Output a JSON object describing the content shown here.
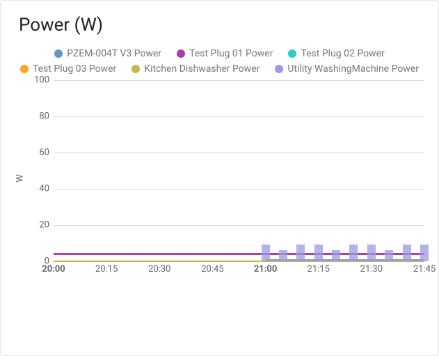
{
  "chart_data": {
    "type": "line",
    "title": "Power (W)",
    "ylabel": "W",
    "xlabel": "",
    "ylim": [
      0,
      100
    ],
    "y_ticks": [
      0,
      20,
      40,
      60,
      80,
      100
    ],
    "x_ticks": [
      "20:00",
      "20:15",
      "20:30",
      "20:45",
      "21:00",
      "21:15",
      "21:30",
      "21:45"
    ],
    "x_bold_ticks": [
      "20:00",
      "21:00"
    ],
    "categories": [
      "20:00",
      "20:05",
      "20:10",
      "20:15",
      "20:20",
      "20:25",
      "20:30",
      "20:35",
      "20:40",
      "20:45",
      "20:50",
      "20:55",
      "21:00",
      "21:05",
      "21:10",
      "21:15",
      "21:20",
      "21:25",
      "21:30",
      "21:35",
      "21:40",
      "21:45"
    ],
    "series": [
      {
        "name": "PZEM-004T V3 Power",
        "color": "#6495c8",
        "values": [
          4,
          4,
          4,
          4,
          4,
          4,
          4,
          4,
          4,
          4,
          4,
          4,
          4,
          4,
          4,
          4,
          4,
          4,
          4,
          4,
          4,
          4
        ]
      },
      {
        "name": "Test Plug 01 Power",
        "color": "#b03fa5",
        "values": [
          4,
          4,
          4,
          4,
          4,
          4,
          4,
          4,
          4,
          4,
          4,
          4,
          4,
          4,
          4,
          4,
          4,
          4,
          4,
          4,
          4,
          4
        ]
      },
      {
        "name": "Test Plug 02 Power",
        "color": "#29d0c7",
        "values": [
          0,
          0,
          0,
          0,
          0,
          0,
          0,
          0,
          0,
          0,
          0,
          0,
          0,
          0,
          0,
          0,
          0,
          0,
          0,
          0,
          0,
          0
        ]
      },
      {
        "name": "Test Plug 03 Power",
        "color": "#f5a623",
        "values": [
          0,
          0,
          0,
          0,
          0,
          0,
          0,
          0,
          0,
          0,
          0,
          0,
          0,
          0,
          0,
          0,
          0,
          0,
          0,
          0,
          0,
          0
        ]
      },
      {
        "name": "Kitchen Dishwasher Power",
        "color": "#c7b84a",
        "values": [
          0,
          0,
          0,
          0,
          0,
          0,
          0,
          0,
          0,
          0,
          0,
          0,
          0,
          0,
          0,
          0,
          0,
          0,
          0,
          0,
          0,
          0
        ]
      },
      {
        "name": "Utility WashingMachine Power",
        "color": "#9a9ae0",
        "values": [
          0,
          0,
          0,
          0,
          0,
          0,
          0,
          0,
          0,
          0,
          0,
          0,
          7,
          4,
          7,
          7,
          4,
          7,
          7,
          4,
          7,
          7
        ]
      }
    ]
  }
}
